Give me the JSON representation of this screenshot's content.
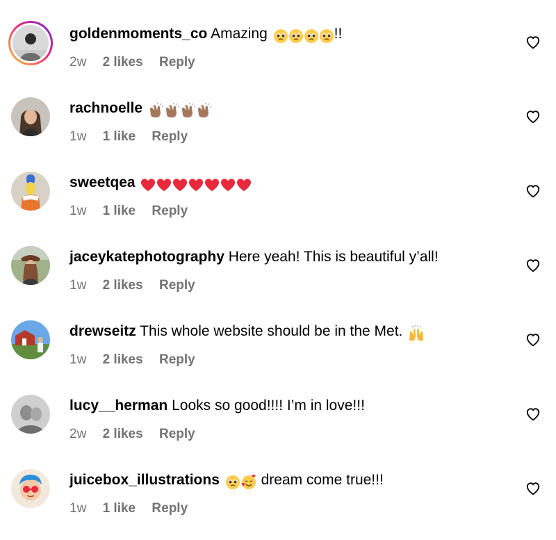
{
  "comments": [
    {
      "username": "goldenmoments_co",
      "text": "Amazing",
      "text_after": "!!",
      "emojis": [
        "pleading-face-emoji",
        "pleading-face-emoji",
        "pleading-face-emoji",
        "pleading-face-emoji"
      ],
      "time": "2w",
      "likes": "2 likes",
      "reply": "Reply",
      "has_story": true
    },
    {
      "username": "rachnoelle",
      "text": "",
      "text_after": "",
      "emojis": [
        "clapping-hands-emoji",
        "clapping-hands-emoji",
        "clapping-hands-emoji",
        "clapping-hands-emoji"
      ],
      "time": "1w",
      "likes": "1 like",
      "reply": "Reply",
      "has_story": false
    },
    {
      "username": "sweetqea",
      "text": "",
      "text_after": "",
      "emojis": [
        "red-heart-emoji",
        "red-heart-emoji",
        "red-heart-emoji",
        "red-heart-emoji",
        "red-heart-emoji",
        "red-heart-emoji",
        "red-heart-emoji"
      ],
      "time": "1w",
      "likes": "1 like",
      "reply": "Reply",
      "has_story": false
    },
    {
      "username": "jaceykatephotography",
      "text": "Here yeah! This is beautiful y’all!",
      "text_after": "",
      "emojis": [],
      "time": "1w",
      "likes": "2 likes",
      "reply": "Reply",
      "has_story": false
    },
    {
      "username": "drewseitz",
      "text": "This whole website should be in the Met.",
      "text_after": "",
      "emojis": [
        "raising-hands-emoji"
      ],
      "time": "1w",
      "likes": "2 likes",
      "reply": "Reply",
      "has_story": false
    },
    {
      "username": "lucy__herman",
      "text": "Looks so good!!!! I’m in love!!!",
      "text_after": "",
      "emojis": [],
      "time": "2w",
      "likes": "2 likes",
      "reply": "Reply",
      "has_story": false
    },
    {
      "username": "juicebox_illustrations",
      "text": "",
      "text_after": "dream come true!!!",
      "emojis": [
        "pleading-face-emoji",
        "smiling-face-with-hearts-emoji"
      ],
      "time": "1w",
      "likes": "1 like",
      "reply": "Reply",
      "has_story": false
    }
  ],
  "colors": {
    "meta_text": "#737373",
    "heart_outline": "#000000",
    "story_ring_start": "#f9ce34",
    "story_ring_end": "#6228d7"
  },
  "icons": {
    "like": "heart-outline-icon"
  }
}
